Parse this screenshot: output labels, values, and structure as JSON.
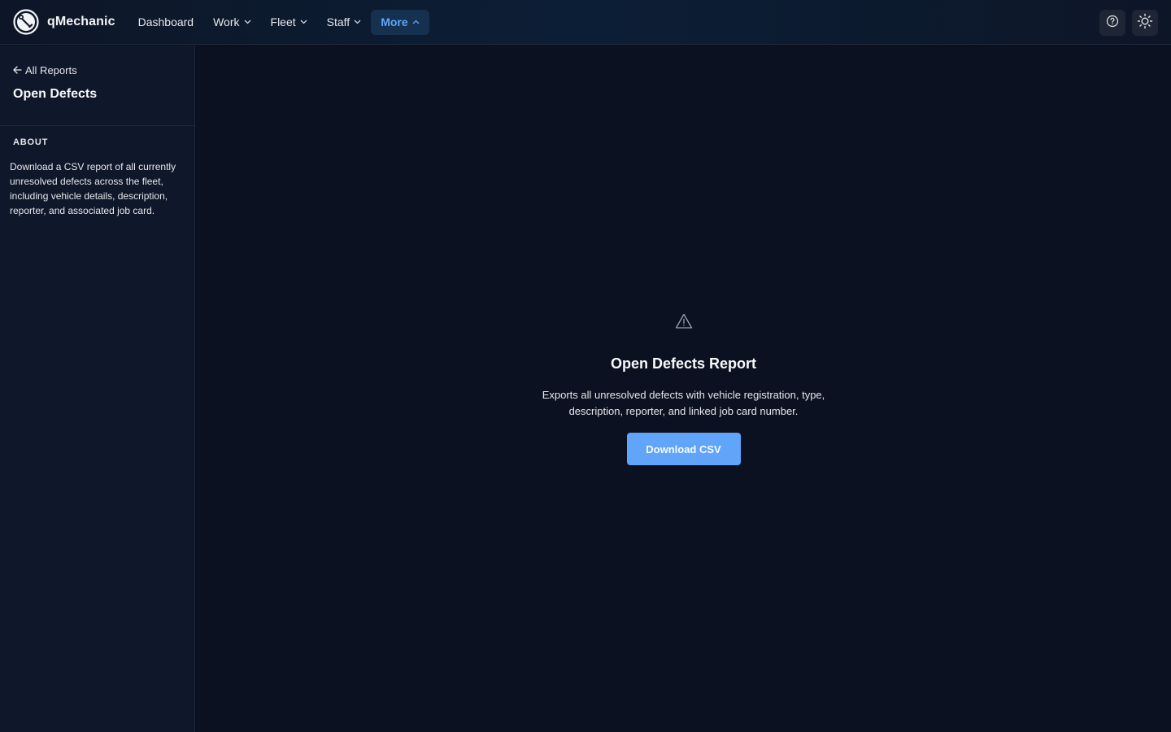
{
  "app": {
    "name": "qMechanic",
    "logo_icon": "wrench-logo-icon"
  },
  "nav": {
    "items": [
      {
        "label": "Dashboard",
        "dropdown": false,
        "active": false
      },
      {
        "label": "Work",
        "dropdown": true,
        "active": false
      },
      {
        "label": "Fleet",
        "dropdown": true,
        "active": false
      },
      {
        "label": "Staff",
        "dropdown": true,
        "active": false
      },
      {
        "label": "More",
        "dropdown": true,
        "active": true
      }
    ]
  },
  "top_actions": {
    "help_icon": "help-circle-icon",
    "theme_icon": "sun-icon"
  },
  "sidebar": {
    "back_label": "All Reports",
    "title": "Open Defects",
    "about_label": "ABOUT",
    "about_text": "Download a CSV report of all currently unresolved defects across the fleet, including vehicle details, description, reporter, and associated job card."
  },
  "main": {
    "icon": "warning-triangle-icon",
    "title": "Open Defects Report",
    "description": "Exports all unresolved defects with vehicle registration, type, description, reporter, and linked job card number.",
    "download_label": "Download CSV"
  },
  "colors": {
    "accent": "#60a5fa",
    "background": "#0b1120",
    "sidebar": "#0f172a",
    "active_nav_bg": "#16304f"
  }
}
